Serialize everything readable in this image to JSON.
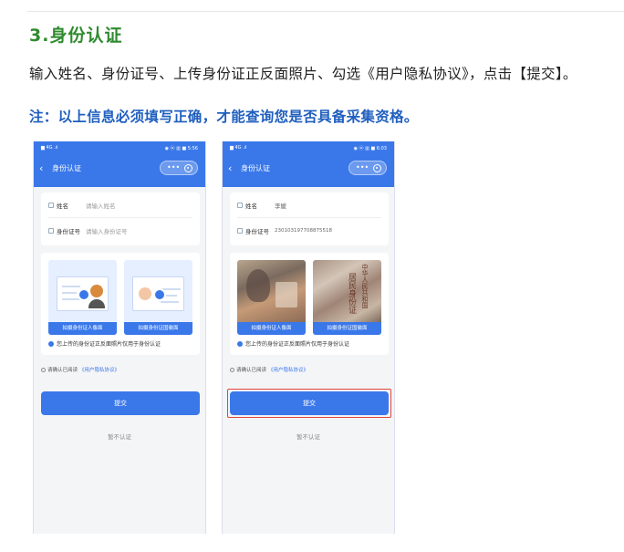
{
  "section": {
    "heading": "3.身份认证",
    "description": "输入姓名、身份证号、上传身份证正反面照片、勾选《用户隐私协议》，点击【提交】。",
    "note": "注：以上信息必须填写正确，才能查询您是否具备采集资格。"
  },
  "phones": [
    {
      "status_left": "▆ 4G .ıl",
      "status_right": "◉ ⓦ ▥ ■ 5:56",
      "nav_title": "身份认证",
      "capsule_dots": "•••",
      "name_label": "姓名",
      "name_value": "请输入姓名",
      "id_label": "身份证号",
      "id_value": "请输入身份证号",
      "front_label": "拍摄身份证人像面",
      "back_label": "拍摄身份证国徽面",
      "photo_note": "您上传的身份证正反面照片仅用于身份认证",
      "agree_text": "请确认已阅读",
      "agree_link": "《用户隐私协议》",
      "submit_label": "提交",
      "later_label": "暂不认证"
    },
    {
      "status_left": "▆ 4G .ıl",
      "status_right": "◉ ⓦ ▥ ■ 6:03",
      "nav_title": "身份认证",
      "capsule_dots": "•••",
      "name_label": "姓名",
      "name_value": "李媛",
      "id_label": "身份证号",
      "id_value": "230103197708875518",
      "front_label": "拍摄身份证人像面",
      "back_label": "拍摄身份证国徽面",
      "card_text": "中华人民共和国",
      "card_text2": "居民身份证",
      "photo_note": "您上传的身份证正反面照片仅用于身份认证",
      "agree_text": "请确认已阅读",
      "agree_link": "《用户隐私协议》",
      "submit_label": "提交",
      "later_label": "暂不认证"
    }
  ],
  "colors": {
    "heading_green": "#2e8b2e",
    "note_blue": "#1f5fbf",
    "app_blue": "#3a78ea",
    "highlight_red": "#e0463a"
  }
}
